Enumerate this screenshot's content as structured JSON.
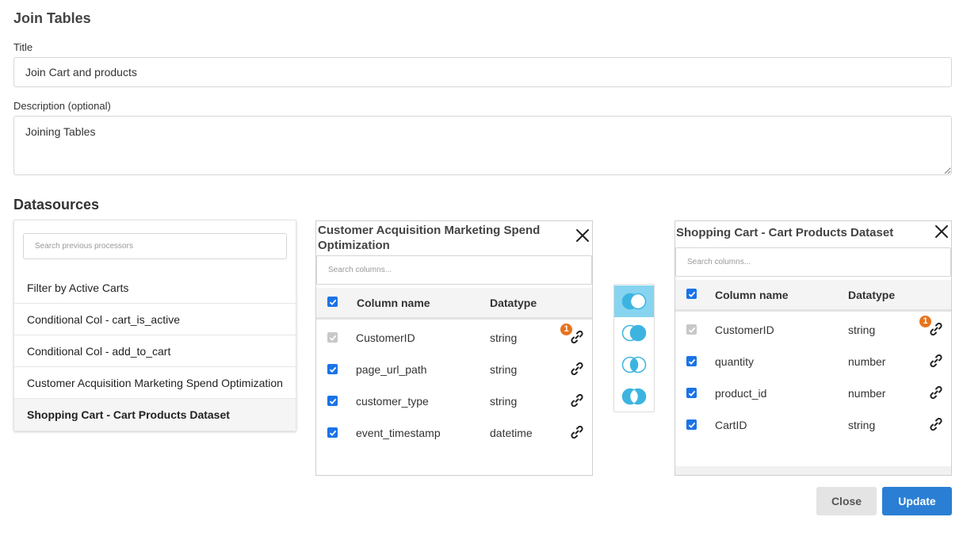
{
  "page": {
    "title": "Join Tables"
  },
  "form": {
    "title_label": "Title",
    "title_value": "Join Cart and products",
    "description_label": "Description (optional)",
    "description_value": "Joining Tables"
  },
  "datasources": {
    "section_title": "Datasources",
    "search_placeholder": "Search previous processors",
    "processors": [
      "Filter by Active Carts",
      "Conditional Col - cart_is_active",
      "Conditional Col - add_to_cart",
      "Customer Acquisition Marketing Spend Optimization",
      "Shopping Cart - Cart Products Dataset"
    ],
    "selected_index": 4
  },
  "left_table": {
    "title": "Customer Acquisition Marketing Spend Optimization",
    "search_placeholder": "Search columns...",
    "header": {
      "column_name": "Column name",
      "datatype": "Datatype"
    },
    "rows": [
      {
        "name": "CustomerID",
        "type": "string",
        "checked": true,
        "disabled": true,
        "badge": "1"
      },
      {
        "name": "page_url_path",
        "type": "string",
        "checked": true,
        "disabled": false,
        "badge": ""
      },
      {
        "name": "customer_type",
        "type": "string",
        "checked": true,
        "disabled": false,
        "badge": ""
      },
      {
        "name": "event_timestamp",
        "type": "datetime",
        "checked": true,
        "disabled": false,
        "badge": ""
      }
    ]
  },
  "right_table": {
    "title": "Shopping Cart - Cart Products Dataset",
    "search_placeholder": "Search columns...",
    "header": {
      "column_name": "Column name",
      "datatype": "Datatype"
    },
    "rows": [
      {
        "name": "CustomerID",
        "type": "string",
        "checked": true,
        "disabled": true,
        "badge": "1"
      },
      {
        "name": "quantity",
        "type": "number",
        "checked": true,
        "disabled": false,
        "badge": ""
      },
      {
        "name": "product_id",
        "type": "number",
        "checked": true,
        "disabled": false,
        "badge": ""
      },
      {
        "name": "CartID",
        "type": "string",
        "checked": true,
        "disabled": false,
        "badge": ""
      }
    ]
  },
  "join_types": {
    "options": [
      "left-join-icon",
      "right-join-icon",
      "inner-join-icon",
      "outer-join-icon"
    ],
    "active_index": 0,
    "colors": {
      "fill": "#3db4e0",
      "active_bg": "#86d4ef"
    }
  },
  "actions": {
    "close_label": "Close",
    "update_label": "Update"
  },
  "colors": {
    "primary": "#2a7fd4",
    "badge": "#e8731c",
    "checkbox": "#1a73e8"
  }
}
